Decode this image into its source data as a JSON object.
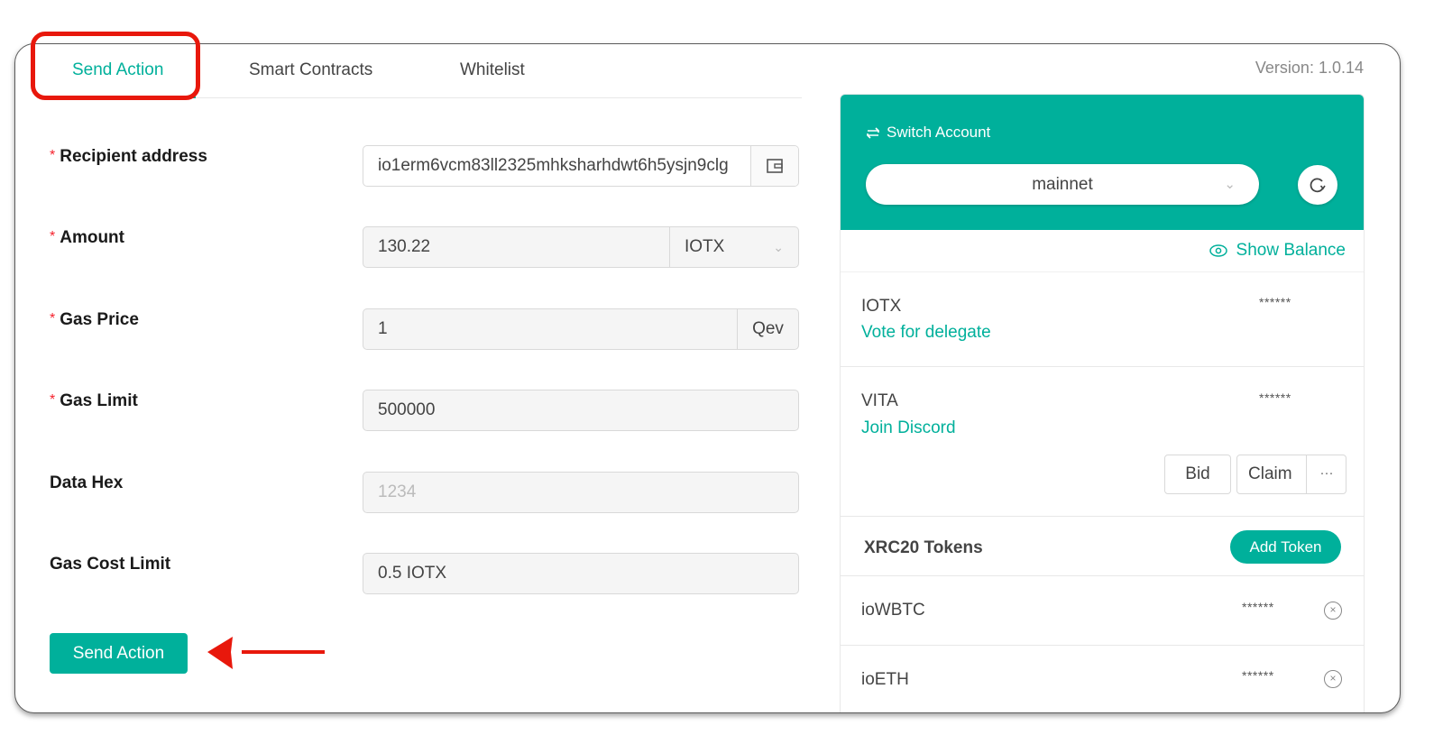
{
  "tabs": [
    {
      "label": "Send Action",
      "active": true
    },
    {
      "label": "Smart Contracts",
      "active": false
    },
    {
      "label": "Whitelist",
      "active": false
    }
  ],
  "version": "Version: 1.0.14",
  "form": {
    "required_mark": "*",
    "recipient": {
      "label": "Recipient address",
      "value": "io1erm6vcm83ll2325mhksharhdwt6h5ysjn9clg",
      "addon_icon": "wallet-icon"
    },
    "amount": {
      "label": "Amount",
      "value": "130.22",
      "unit": "IOTX"
    },
    "gas_price": {
      "label": "Gas Price",
      "value": "1",
      "unit": "Qev"
    },
    "gas_limit": {
      "label": "Gas Limit",
      "value": "500000"
    },
    "data_hex": {
      "label": "Data Hex",
      "placeholder": "1234"
    },
    "gas_cost_limit": {
      "label": "Gas Cost Limit",
      "value": "0.5 IOTX"
    },
    "submit_label": "Send Action"
  },
  "account": {
    "switch_label": "Switch Account",
    "network": "mainnet",
    "show_balance_label": "Show Balance",
    "tokens": [
      {
        "name": "IOTX",
        "balance": "******",
        "link": "Vote for delegate"
      },
      {
        "name": "VITA",
        "balance": "******",
        "link": "Join Discord"
      }
    ],
    "vita_actions": {
      "bid": "Bid",
      "claim": "Claim",
      "more": "···"
    },
    "xrc20": {
      "title": "XRC20 Tokens",
      "add_label": "Add Token",
      "items": [
        {
          "name": "ioWBTC",
          "balance": "******"
        },
        {
          "name": "ioETH",
          "balance": "******"
        }
      ]
    }
  },
  "colors": {
    "accent": "#00b09b",
    "annotation": "#e8180c",
    "required": "#f5222d"
  }
}
